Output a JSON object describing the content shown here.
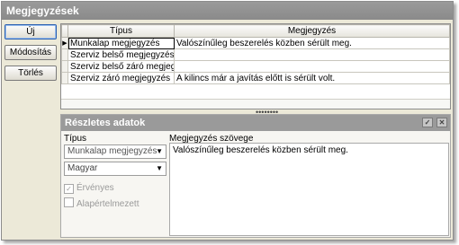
{
  "title": "Megjegyzések",
  "buttons": {
    "new": "Új",
    "edit": "Módosítás",
    "delete": "Törlés"
  },
  "grid": {
    "columns": [
      "Típus",
      "Megjegyzés"
    ],
    "rows": [
      {
        "type": "Munkalap megjegyzés",
        "note": "Valószínűleg beszerelés közben sérült meg.",
        "selected": true
      },
      {
        "type": "Szerviz belső megjegyzés",
        "note": ""
      },
      {
        "type": "Szerviz belső záró megjegyzés",
        "note": ""
      },
      {
        "type": "Szerviz záró megjegyzés",
        "note": "A kilincs már a javítás előtt is sérült volt."
      }
    ]
  },
  "details": {
    "title": "Részletes adatok",
    "type_label": "Típus",
    "type_value": "Munkalap megjegyzés",
    "language_value": "Magyar",
    "valid_label": "Érvényes",
    "default_label": "Alapértelmezett",
    "text_label": "Megjegyzés szövege",
    "text_value": "Valószínűleg beszerelés közben sérült meg."
  }
}
